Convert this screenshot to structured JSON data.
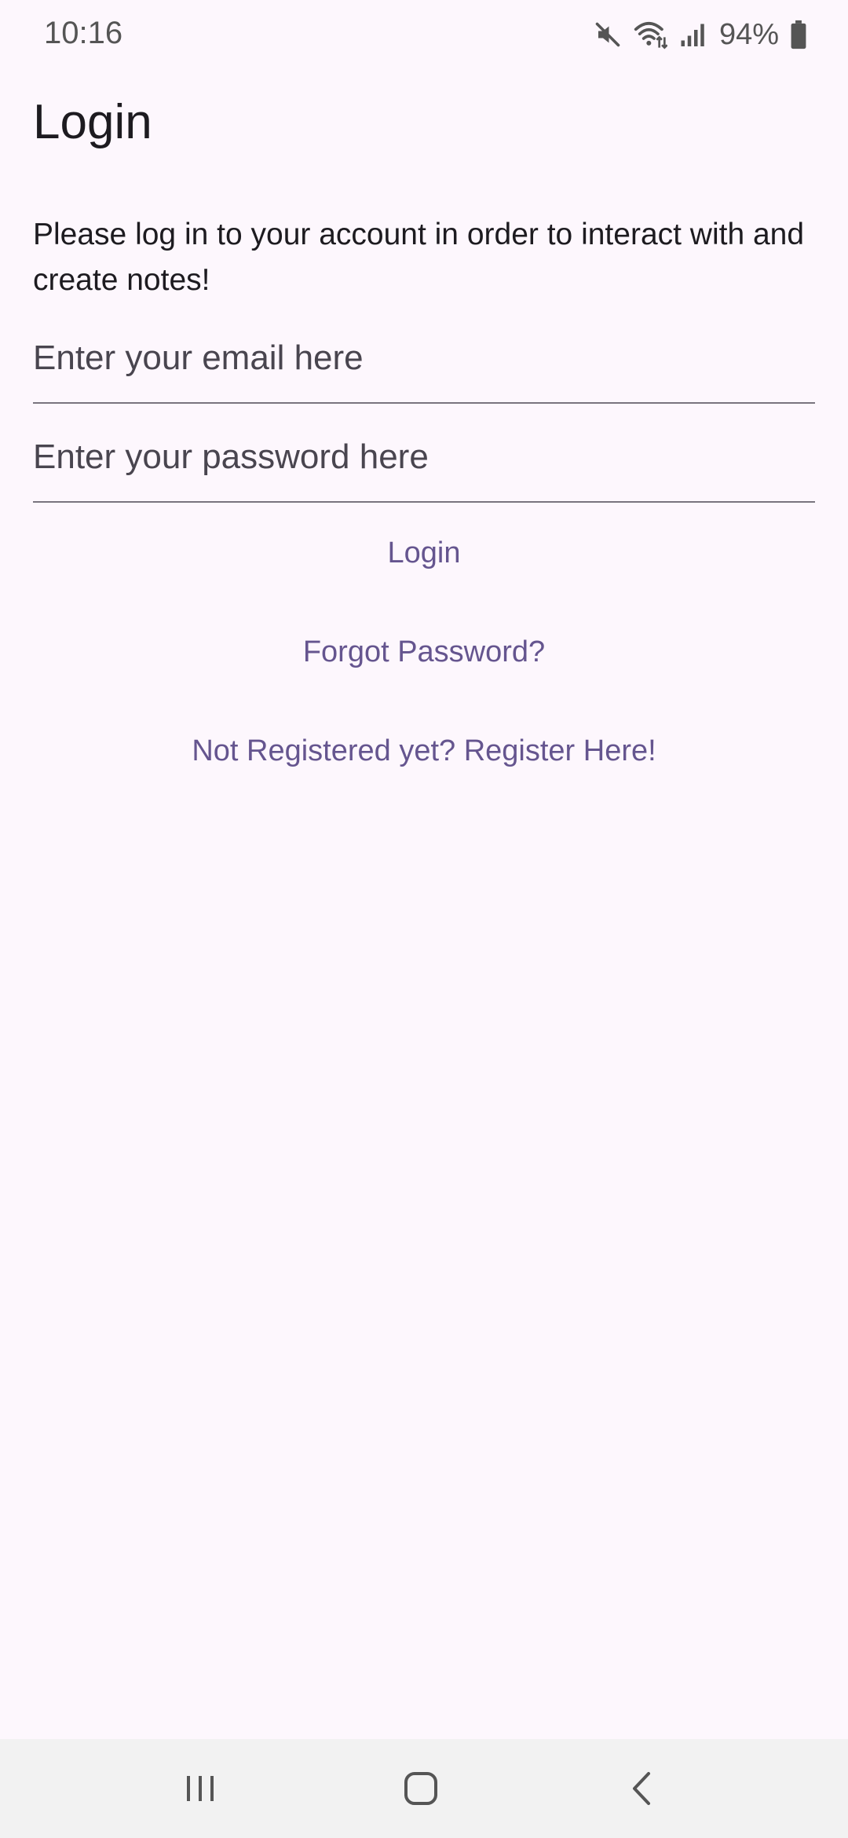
{
  "status_bar": {
    "time": "10:16",
    "battery_percent": "94%",
    "icons": [
      "mute-icon",
      "wifi-icon",
      "signal-icon",
      "battery-icon"
    ]
  },
  "page": {
    "title": "Login",
    "intro": "Please log in to your account in order to interact with and create notes!"
  },
  "form": {
    "email_placeholder": "Enter your email here",
    "email_value": "",
    "password_placeholder": "Enter your password here",
    "password_value": ""
  },
  "actions": {
    "login_label": "Login",
    "forgot_label": "Forgot Password?",
    "register_label": "Not Registered yet? Register Here!"
  },
  "navigation": {
    "icons": [
      "recent-apps-icon",
      "home-icon",
      "back-icon"
    ]
  },
  "colors": {
    "background": "#fdf7fd",
    "accent": "#65558f",
    "text": "#1d1b20",
    "divider": "#79747e",
    "nav_bar": "#f2f2f2"
  }
}
